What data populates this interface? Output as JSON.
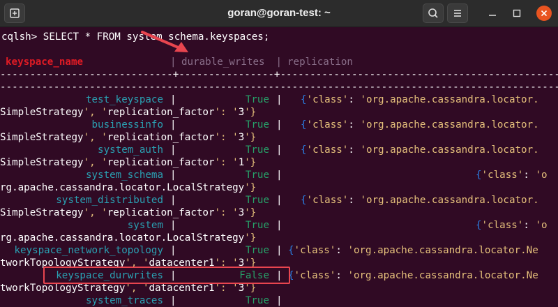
{
  "window": {
    "title": "goran@goran-test: ~"
  },
  "terminal": {
    "command": "cqlsh> SELECT * FROM system_schema.keyspaces;",
    "header": {
      "col1": "keyspace_name",
      "sep1": "| ",
      "col2": "durable_writes",
      "sep2": " | ",
      "col3": "replication"
    },
    "divider1": "-----------------------------+----------------+-------------------------------------------------------------------",
    "divider2": "------------------------------------------------------------------------------------------------",
    "rows": [
      {
        "name": "test_keyspace",
        "durable": "True",
        "repl1": "{'class': 'org.apache.cassandra.locator.",
        "repl2": "SimpleStrategy', 'replication_factor': '3'}"
      },
      {
        "name": "businessinfo",
        "durable": "True",
        "repl1": "{'class': 'org.apache.cassandra.locator.",
        "repl2": "SimpleStrategy', 'replication_factor': '3'}"
      },
      {
        "name": "system_auth",
        "durable": "True",
        "repl1": "{'class': 'org.apache.cassandra.locator.",
        "repl2": "SimpleStrategy', 'replication_factor': '1'}"
      },
      {
        "name": "system_schema",
        "durable": "True",
        "repl1": "{'class': 'o",
        "repl2": "rg.apache.cassandra.locator.LocalStrategy'}"
      },
      {
        "name": "system_distributed",
        "durable": "True",
        "repl1": "{'class': 'org.apache.cassandra.locator.",
        "repl2": "SimpleStrategy', 'replication_factor': '3'}"
      },
      {
        "name": "system",
        "durable": "True",
        "repl1": "{'class': 'o",
        "repl2": "rg.apache.cassandra.locator.LocalStrategy'}"
      },
      {
        "name": "keyspace_network_topology",
        "durable": "True",
        "repl1": "{'class': 'org.apache.cassandra.locator.Ne",
        "repl2": "tworkTopologyStrategy', 'datacenter1': '3'}"
      },
      {
        "name": "keyspace_durwrites",
        "durable": "False",
        "repl1": "{'class': 'org.apache.cassandra.locator.Ne",
        "repl2": "tworkTopologyStrategy', 'datacenter1': '3'}"
      },
      {
        "name": "system_traces",
        "durable": "True",
        "repl1": "",
        "repl2": ""
      }
    ]
  },
  "colors": {
    "terminal_bg": "#300a24",
    "titlebar_bg": "#2c2c2c",
    "accent_close": "#e95420",
    "annotation_red": "#e8454f"
  },
  "icons": [
    "new-tab-icon",
    "search-icon",
    "menu-icon",
    "minimize-icon",
    "maximize-icon",
    "close-icon"
  ]
}
